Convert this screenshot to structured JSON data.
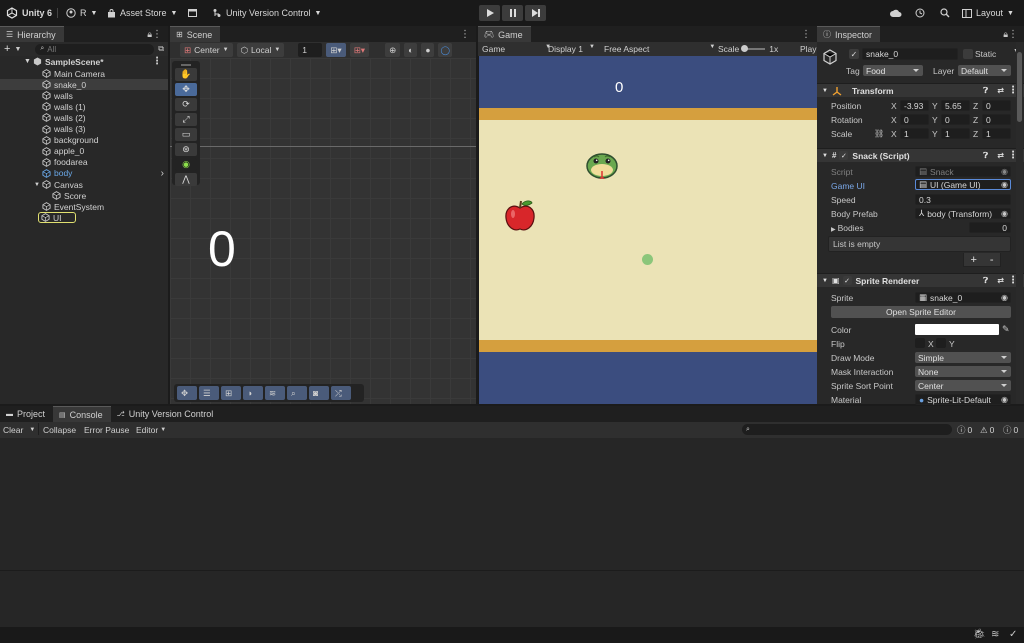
{
  "toolbar": {
    "app_name": "Unity 6",
    "account": "R",
    "asset_store": "Asset Store",
    "version_control": "Unity Version Control",
    "layout": "Layout"
  },
  "hierarchy": {
    "tab": "Hierarchy",
    "search_placeholder": "All",
    "scene": "SampleScene*",
    "items": [
      {
        "label": "Main Camera"
      },
      {
        "label": "snake_0"
      },
      {
        "label": "walls"
      },
      {
        "label": "walls (1)"
      },
      {
        "label": "walls (2)"
      },
      {
        "label": "walls (3)"
      },
      {
        "label": "background"
      },
      {
        "label": "apple_0"
      },
      {
        "label": "foodarea"
      },
      {
        "label": "body"
      },
      {
        "label": "Canvas"
      },
      {
        "label": "Score"
      },
      {
        "label": "EventSystem"
      },
      {
        "label": "UI"
      }
    ]
  },
  "scene": {
    "tab": "Scene",
    "pivot": "Center",
    "space": "Local",
    "snap_value": "1",
    "score_text": "0"
  },
  "game": {
    "tab": "Game",
    "view": "Game",
    "display": "Display 1",
    "aspect": "Free Aspect",
    "scale_label": "Scale",
    "scale_value": "1x",
    "play_label": "Play",
    "score": "0",
    "colors": {
      "top_band": "#3b4d7f",
      "border": "#d59f3e",
      "field": "#ebe3b6",
      "bottom_band": "#3b4d7f",
      "food_dot": "#8bc67a"
    }
  },
  "inspector": {
    "tab": "Inspector",
    "object_name": "snake_0",
    "static_label": "Static",
    "tag_label": "Tag",
    "tag_value": "Food",
    "layer_label": "Layer",
    "layer_value": "Default",
    "transform": {
      "title": "Transform",
      "position_label": "Position",
      "rotation_label": "Rotation",
      "scale_label": "Scale",
      "position": {
        "x": "-3.93",
        "y": "5.65",
        "z": "0"
      },
      "rotation": {
        "x": "0",
        "y": "0",
        "z": "0"
      },
      "scale": {
        "x": "1",
        "y": "1",
        "z": "1"
      }
    },
    "snack": {
      "title": "Snack (Script)",
      "script_label": "Script",
      "script_value": "Snack",
      "gameui_label": "Game UI",
      "gameui_value": "UI (Game UI)",
      "speed_label": "Speed",
      "speed_value": "0.3",
      "bodyprefab_label": "Body Prefab",
      "bodyprefab_value": "body (Transform)",
      "bodies_label": "Bodies",
      "bodies_count": "0",
      "list_empty": "List is empty",
      "plus": "+",
      "minus": "-"
    },
    "sprite_renderer": {
      "title": "Sprite Renderer",
      "sprite_label": "Sprite",
      "sprite_value": "snake_0",
      "open_editor": "Open Sprite Editor",
      "color_label": "Color",
      "flip_label": "Flip",
      "flip_x": "X",
      "flip_y": "Y",
      "drawmode_label": "Draw Mode",
      "drawmode_value": "Simple",
      "mask_label": "Mask Interaction",
      "mask_value": "None",
      "sortpoint_label": "Sprite Sort Point",
      "sortpoint_value": "Center",
      "material_label": "Material",
      "material_value": "Sprite-Lit-Default"
    },
    "axis": {
      "x": "X",
      "y": "Y",
      "z": "Z"
    }
  },
  "console": {
    "tabs": [
      "Project",
      "Console",
      "Unity Version Control"
    ],
    "clear": "Clear",
    "collapse": "Collapse",
    "error_pause": "Error Pause",
    "editor": "Editor",
    "counts": {
      "info": "0",
      "warn": "0",
      "error": "0"
    }
  }
}
